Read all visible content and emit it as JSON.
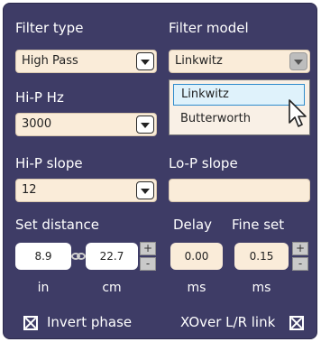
{
  "labels": {
    "filter_type": "Filter type",
    "filter_model": "Filter model",
    "hip_hz": "Hi-P Hz",
    "hip_slope": "Hi-P slope",
    "lop_slope": "Lo-P slope",
    "set_distance": "Set distance",
    "delay": "Delay",
    "fine_set": "Fine set",
    "invert_phase": "Invert phase",
    "xover_link": "XOver L/R link"
  },
  "filter_type": {
    "value": "High Pass"
  },
  "filter_model": {
    "value": "Linkwitz",
    "options": [
      "Linkwitz",
      "Butterworth"
    ],
    "highlighted": "Linkwitz"
  },
  "hip_hz": {
    "value": "3000"
  },
  "hip_slope": {
    "value": "12"
  },
  "lop_slope": {
    "value": ""
  },
  "distance": {
    "inches": "8.9",
    "cm": "22.7",
    "unit_in": "in",
    "unit_cm": "cm",
    "plus": "+",
    "minus": "-"
  },
  "delay": {
    "value": "0.00",
    "unit": "ms"
  },
  "fine_set": {
    "value": "0.15",
    "unit": "ms",
    "plus": "+",
    "minus": "-"
  },
  "checkboxes": {
    "invert_phase": true,
    "xover_link": true
  },
  "colors": {
    "panel": "#3e3c66",
    "field": "#faecd9",
    "highlight": "#dff2fb"
  }
}
